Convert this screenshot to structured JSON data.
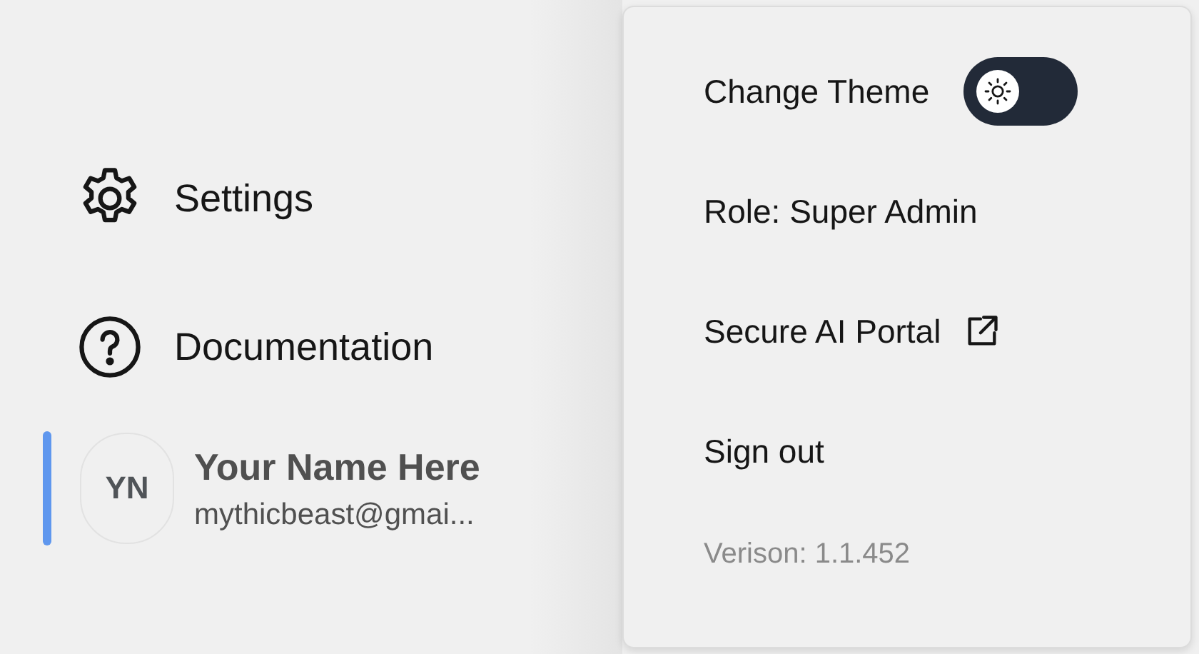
{
  "sidebar": {
    "items": [
      {
        "kind": "settings",
        "label": "Settings"
      },
      {
        "kind": "help",
        "label": "Documentation"
      }
    ],
    "user": {
      "initials": "YN",
      "name": "Your Name Here",
      "email": "mythicbeast@gmai...",
      "selected": true
    }
  },
  "menu": {
    "items": [
      {
        "kind": "toggle",
        "label": "Change Theme",
        "on": false
      },
      {
        "kind": "text",
        "label": "Role: Super Admin"
      },
      {
        "kind": "external",
        "label": "Secure AI Portal"
      },
      {
        "kind": "text",
        "label": "Sign out"
      }
    ],
    "version": "Verison: 1.1.452"
  }
}
